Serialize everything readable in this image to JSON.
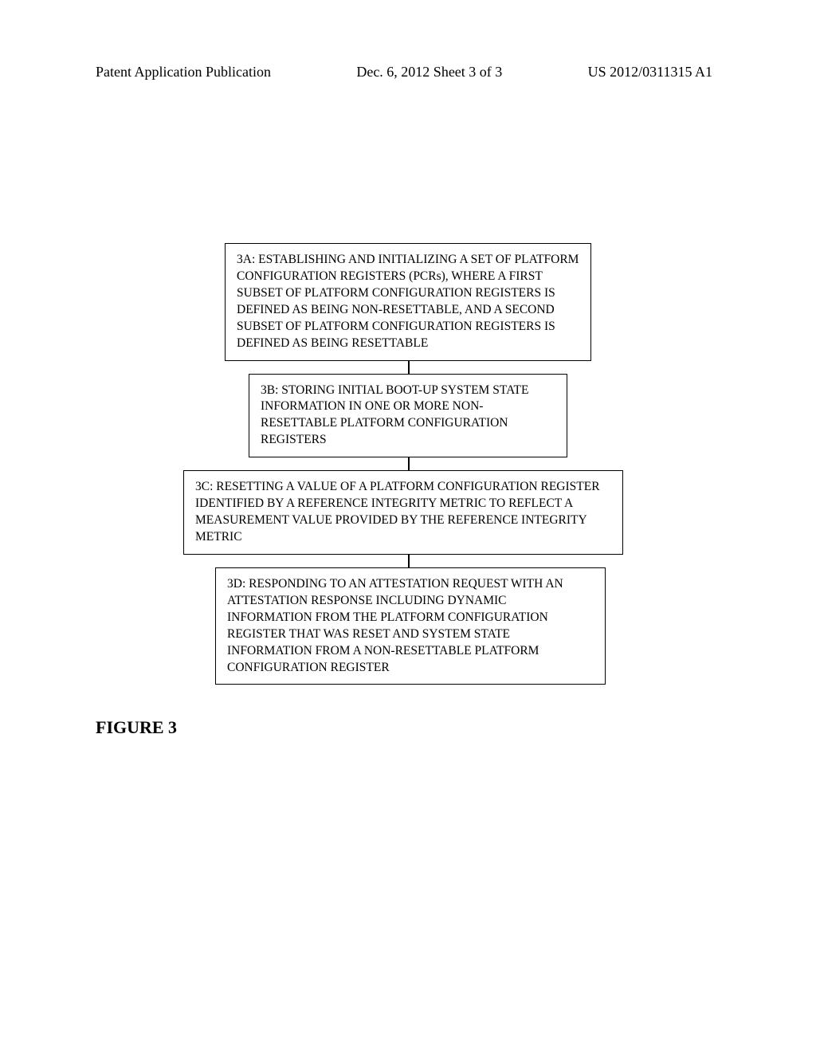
{
  "header": {
    "left": "Patent Application Publication",
    "center": "Dec. 6, 2012  Sheet 3 of 3",
    "right": "US 2012/0311315 A1"
  },
  "flowchart": {
    "box_3a": "3A: ESTABLISHING AND INITIALIZING  A SET OF PLATFORM CONFIGURATION REGISTERS (PCRs), WHERE A FIRST SUBSET OF PLATFORM CONFIGURATION REGISTERS IS DEFINED AS BEING NON-RESETTABLE, AND A SECOND SUBSET OF PLATFORM CONFIGURATION REGISTERS IS DEFINED AS BEING RESETTABLE",
    "box_3b": "3B: STORING INITIAL BOOT-UP SYSTEM STATE INFORMATION IN ONE OR MORE NON-RESETTABLE PLATFORM CONFIGURATION REGISTERS",
    "box_3c": "3C: RESETTING A VALUE OF A PLATFORM CONFIGURATION REGISTER IDENTIFIED BY A REFERENCE INTEGRITY METRIC TO REFLECT A MEASUREMENT VALUE PROVIDED BY THE REFERENCE INTEGRITY METRIC",
    "box_3d": "3D: RESPONDING TO AN ATTESTATION REQUEST WITH AN ATTESTATION RESPONSE INCLUDING DYNAMIC INFORMATION FROM THE PLATFORM CONFIGURATION REGISTER THAT WAS RESET AND SYSTEM STATE INFORMATION FROM A NON-RESETTABLE PLATFORM CONFIGURATION REGISTER"
  },
  "figure_label": "FIGURE 3"
}
